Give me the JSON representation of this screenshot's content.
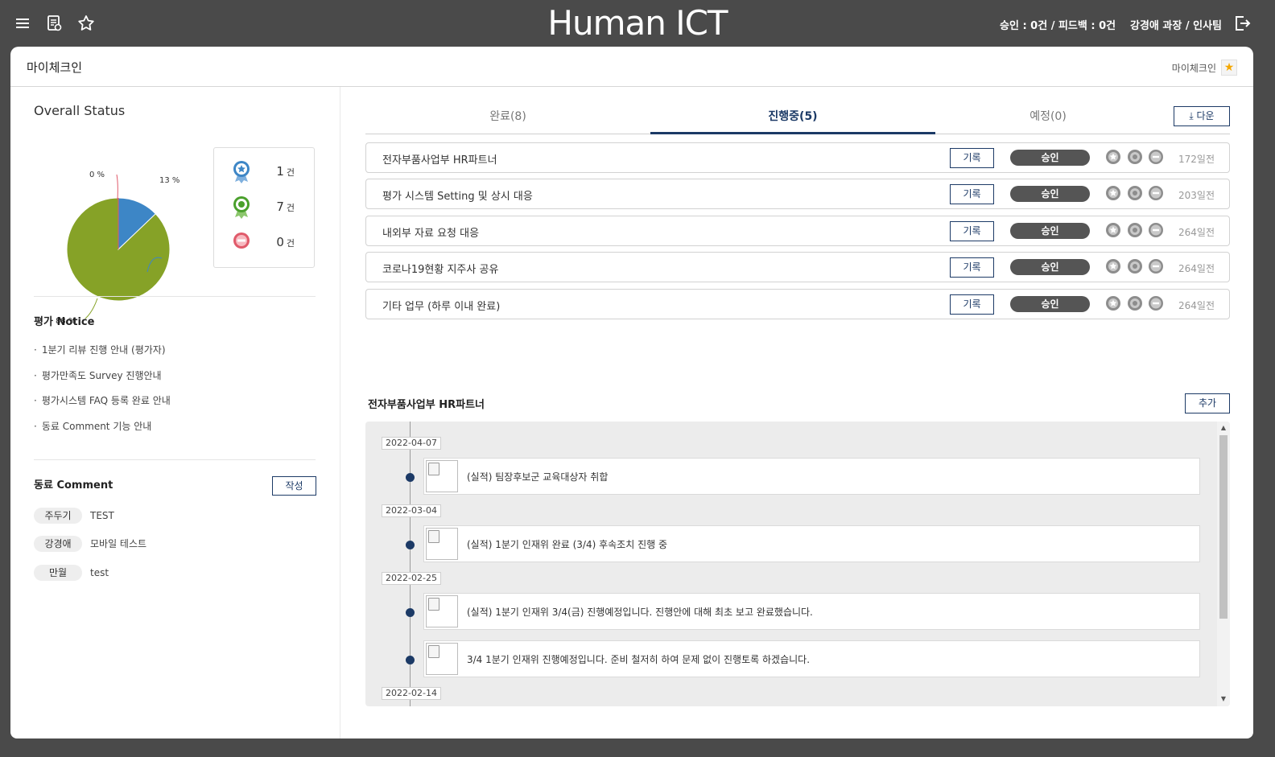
{
  "header": {
    "logo": "Human ICT",
    "status_text": "승인 : 0건 / 피드백 : 0건",
    "user_text": "강경애 과장 / 인사팀"
  },
  "page": {
    "title": "마이체크인",
    "crumb": "마이체크인"
  },
  "overall": {
    "title": "Overall Status",
    "pie": {
      "slices": [
        {
          "label": "13 %",
          "value": 13,
          "color": "#3d86c6"
        },
        {
          "label": "88 %",
          "value": 88,
          "color": "#86a227"
        },
        {
          "label": "0 %",
          "value": 0,
          "color": "#e05a6a"
        }
      ]
    },
    "stats": [
      {
        "icon": "blue-star-medal-icon",
        "count": "1",
        "unit": "건",
        "color": "#3d86c6"
      },
      {
        "icon": "green-medal-icon",
        "count": "7",
        "unit": "건",
        "color": "#4aa02c"
      },
      {
        "icon": "red-minus-icon",
        "count": "0",
        "unit": "건",
        "color": "#e05a6a"
      }
    ]
  },
  "notice": {
    "title": "평가 Notice",
    "items": [
      "1분기 리뷰 진행 안내 (평가자)",
      "평가만족도 Survey 진행안내",
      "평가시스템 FAQ 등록 완료 안내",
      "동료 Comment 기능 안내"
    ]
  },
  "comments": {
    "title": "동료 Comment",
    "write_label": "작성",
    "items": [
      {
        "name": "주두기",
        "text": "TEST"
      },
      {
        "name": "강경애",
        "text": "모바일 테스트"
      },
      {
        "name": "만월",
        "text": "test"
      }
    ]
  },
  "tabs": {
    "items": [
      "완료(8)",
      "진행중(5)",
      "예정(0)"
    ],
    "active": 1,
    "download_label": "다운"
  },
  "tasks": [
    {
      "title": "전자부품사업부 HR파트너",
      "record": "기록",
      "status": "승인",
      "ago": "172일전"
    },
    {
      "title": "평가 시스템 Setting 및 상시 대응",
      "record": "기록",
      "status": "승인",
      "ago": "203일전"
    },
    {
      "title": "내외부 자료 요청 대응",
      "record": "기록",
      "status": "승인",
      "ago": "264일전"
    },
    {
      "title": "코로나19현황 지주사 공유",
      "record": "기록",
      "status": "승인",
      "ago": "264일전"
    },
    {
      "title": "기타 업무 (하루 이내 완료)",
      "record": "기록",
      "status": "승인",
      "ago": "264일전"
    }
  ],
  "detail": {
    "title": "전자부품사업부 HR파트너",
    "add_label": "추가",
    "timeline": [
      {
        "date": "2022-04-07",
        "text": "(실적) 팀장후보군 교육대상자 취합"
      },
      {
        "date": "2022-03-04",
        "text": "(실적) 1분기 인재위 완료 (3/4) 후속조치 진행 중"
      },
      {
        "date": "2022-02-25",
        "text": "(실적) 1분기 인재위 3/4(금) 진행예정입니다. 진행안에 대해 최초 보고 완료했습니다."
      },
      {
        "date": "",
        "text": "3/4 1분기 인재위 진행예정입니다. 준비 철저히 하여 문제 없이 진행토록 하겠습니다."
      },
      {
        "date": "2022-02-14",
        "text": ""
      }
    ]
  }
}
